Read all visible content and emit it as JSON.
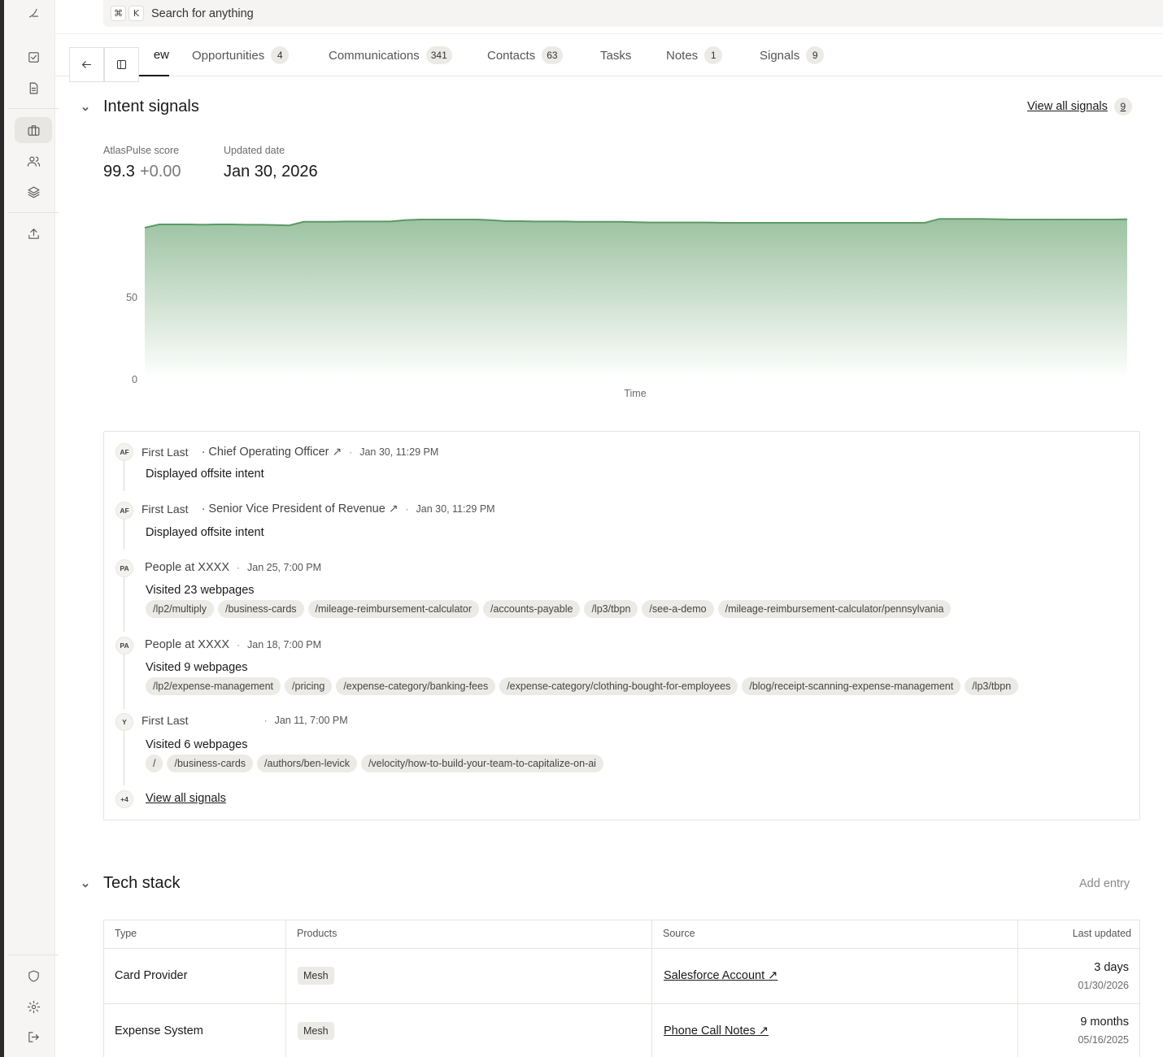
{
  "search": {
    "cmd_key": "⌘",
    "k_key": "K",
    "placeholder": "Search for anything"
  },
  "sidebar": {
    "items": [
      {
        "icon": "logo-icon"
      },
      {
        "icon": "task-check-icon"
      },
      {
        "icon": "document-icon"
      },
      {
        "icon": "briefcase-icon",
        "active": true
      },
      {
        "icon": "users-icon"
      },
      {
        "icon": "layers-icon"
      },
      {
        "icon": "upload-icon"
      },
      {
        "icon": "shield-icon"
      },
      {
        "icon": "gear-icon"
      },
      {
        "icon": "logout-icon"
      }
    ]
  },
  "tabs": [
    {
      "label": "ew",
      "active": true
    },
    {
      "label": "Opportunities",
      "count": "4"
    },
    {
      "label": "Communications",
      "count": "341"
    },
    {
      "label": "Contacts",
      "count": "63"
    },
    {
      "label": "Tasks"
    },
    {
      "label": "Notes",
      "count": "1"
    },
    {
      "label": "Signals",
      "count": "9"
    }
  ],
  "intent": {
    "title": "Intent signals",
    "view_all_label": "View all signals",
    "view_all_count": "9",
    "score_label": "AtlasPulse score",
    "score_value": "99.3",
    "score_delta": "+0.00",
    "updated_label": "Updated date",
    "updated_value": "Jan 30, 2026"
  },
  "chart_data": {
    "type": "area",
    "xlabel": "Time",
    "ylabel": "",
    "y_ticks": [
      "50",
      "0"
    ],
    "ylim": [
      0,
      100
    ],
    "color": "#5b9a63",
    "values": [
      93,
      95,
      95,
      95,
      94.8,
      95,
      95,
      94.8,
      94.8,
      94.6,
      94.4,
      96.6,
      96.6,
      96.6,
      96.8,
      96.8,
      96.8,
      96.8,
      97.6,
      98,
      98,
      98,
      98,
      98,
      97.6,
      97,
      97,
      96.8,
      96.8,
      96.8,
      96.6,
      96.6,
      96.6,
      96.6,
      96.4,
      96.2,
      96.2,
      96.2,
      96.2,
      96.2,
      96,
      96,
      96,
      96,
      96,
      96,
      96,
      96,
      96,
      96,
      96,
      96,
      96,
      96,
      96,
      98.4,
      98.4,
      98.4,
      98.4,
      98.2,
      98,
      98,
      98,
      98,
      98,
      98,
      98,
      98,
      98.2
    ]
  },
  "signals": [
    {
      "avatar": "AF",
      "name": "First Last",
      "title": "· Chief Operating Officer",
      "time": "Jan 30, 11:29 PM",
      "desc": "Displayed offsite intent",
      "chips": []
    },
    {
      "avatar": "AF",
      "name": "First Last",
      "title": "· Senior Vice President of Revenue",
      "time": "Jan 30, 11:29 PM",
      "desc": "Displayed offsite intent",
      "chips": []
    },
    {
      "avatar": "PA",
      "name": "People at XXXX",
      "title": "",
      "time": "Jan 25, 7:00 PM",
      "desc": "Visited 23 webpages",
      "chips": [
        "/lp2/multiply",
        "/business-cards",
        "/mileage-reimbursement-calculator",
        "/accounts-payable",
        "/lp3/tbpn",
        "/see-a-demo",
        "/mileage-reimbursement-calculator/pennsylvania"
      ]
    },
    {
      "avatar": "PA",
      "name": "People at XXXX",
      "title": "",
      "time": "Jan 18, 7:00 PM",
      "desc": "Visited 9 webpages",
      "chips": [
        "/lp2/expense-management",
        "/pricing",
        "/expense-category/banking-fees",
        "/expense-category/clothing-bought-for-employees",
        "/blog/receipt-scanning-expense-management",
        "/lp3/tbpn"
      ]
    },
    {
      "avatar": "Y",
      "name": "First Last",
      "title": "",
      "time": "Jan 11, 7:00 PM",
      "desc": "Visited 6 webpages",
      "chips": [
        "/",
        "/business-cards",
        "/authors/ben-levick",
        "/velocity/how-to-build-your-team-to-capitalize-on-ai"
      ]
    }
  ],
  "signals_more": {
    "avatar": "+4",
    "label": "View all signals"
  },
  "tech": {
    "title": "Tech stack",
    "add_entry": "Add entry",
    "headers": [
      "Type",
      "Products",
      "Source",
      "Last updated"
    ],
    "rows": [
      {
        "type": "Card Provider",
        "product": "Mesh",
        "source": "Salesforce Account",
        "ago": "3 days",
        "date": "01/30/2026"
      },
      {
        "type": "Expense System",
        "product": "Mesh",
        "source": "Phone Call Notes",
        "ago": "9 months",
        "date": "05/16/2025"
      }
    ]
  }
}
